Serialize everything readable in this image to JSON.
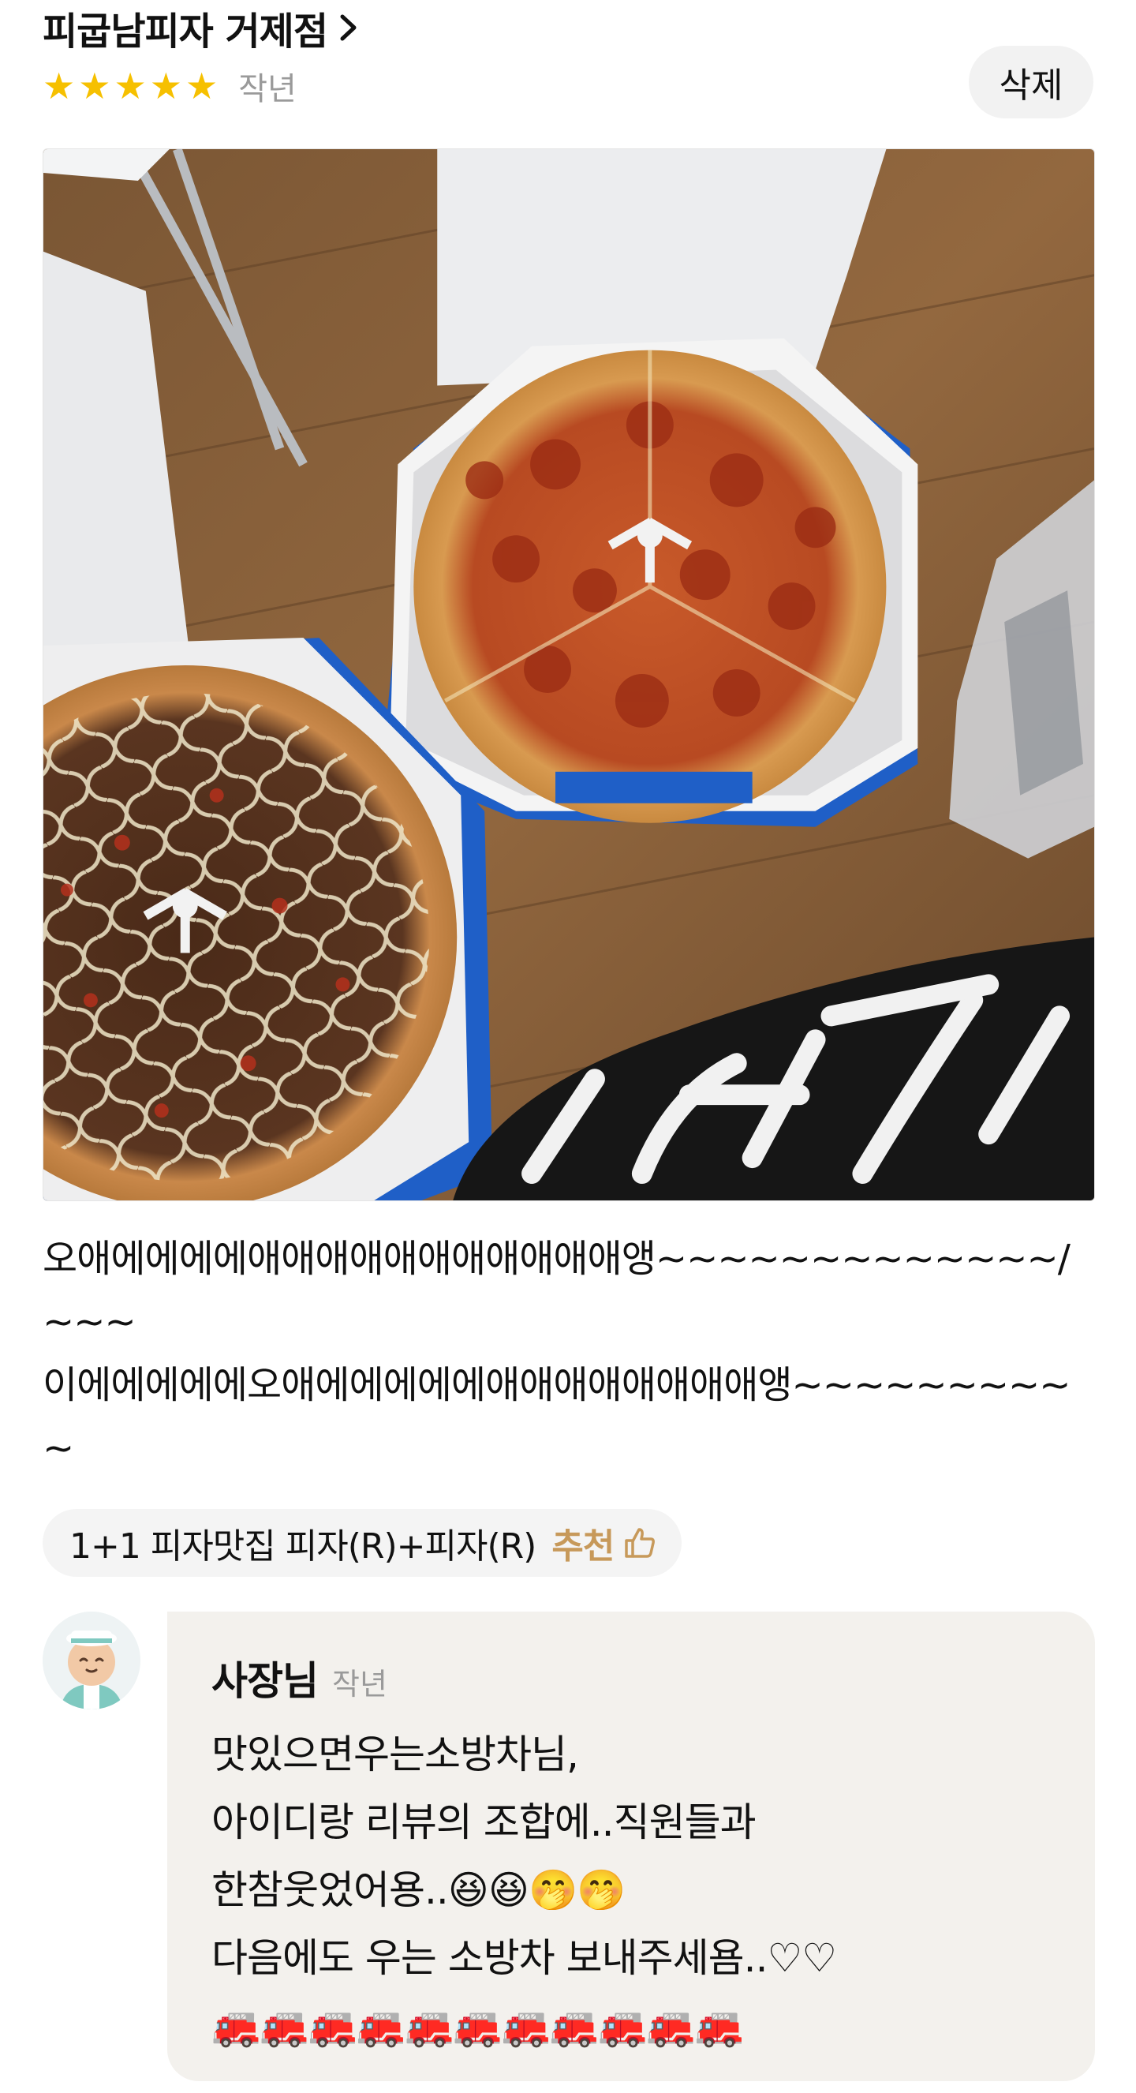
{
  "review": {
    "store_name": "피굽남피자 거제점",
    "rating": 5,
    "stars": [
      "★",
      "★",
      "★",
      "★",
      "★"
    ],
    "date": "작년",
    "delete_label": "삭제",
    "text": "오애에에에에애애애애애애애애애애애앵~~~~~~~~~~~~~/~~~\n이에에에에에오애에에에에에애애애애애애애애앵~~~~~~~~~~",
    "menu_tag": {
      "name": "1+1 피자맛집 피자(R)+피자(R)",
      "recommend_label": "추천",
      "recommend_icon": "thumbs-up-icon"
    }
  },
  "owner_reply": {
    "author": "사장님",
    "date": "작년",
    "body": "맛있으면우는소방차님,\n아이디랑 리뷰의 조합에..직원들과\n한참웃었어용..😆😆🤭🤭\n다음에도 우는 소방차 보내주세욤..♡♡\n🚒🚒🚒🚒🚒🚒🚒🚒🚒🚒🚒"
  },
  "colors": {
    "star": "#f6c000",
    "recommend": "#c7995a",
    "reply_bg": "#f3f1ed",
    "button_bg": "#f2f2f2"
  }
}
